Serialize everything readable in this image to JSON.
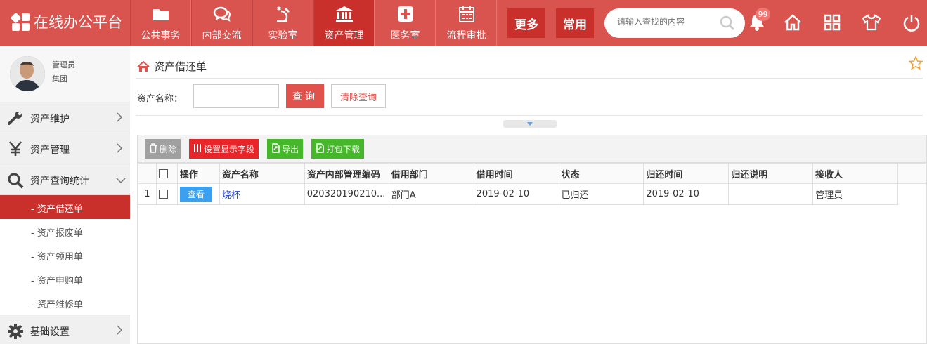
{
  "app": {
    "title": "在线办公平台"
  },
  "nav": [
    {
      "label": "公共事务",
      "icon": "folder-icon"
    },
    {
      "label": "内部交流",
      "icon": "chat-icon"
    },
    {
      "label": "实验室",
      "icon": "lab-icon"
    },
    {
      "label": "资产管理",
      "icon": "bank-icon",
      "active": true
    },
    {
      "label": "医务室",
      "icon": "medical-cross-icon"
    },
    {
      "label": "流程审批",
      "icon": "calendar-icon"
    }
  ],
  "header": {
    "more_label": "更多",
    "common_label": "常用",
    "search_placeholder": "请输入查找的内容",
    "notification_count": "99"
  },
  "user": {
    "name": "管理员",
    "group": "集团"
  },
  "sidebar": {
    "menus": [
      {
        "label": "资产维护",
        "icon": "wrench-icon"
      },
      {
        "label": "资产管理",
        "icon": "yen-icon"
      },
      {
        "label": "资产查询统计",
        "icon": "search-icon",
        "expanded": true
      }
    ],
    "submenu": [
      {
        "label": "- 资产借还单",
        "active": true
      },
      {
        "label": "- 资产报废单"
      },
      {
        "label": "- 资产领用单"
      },
      {
        "label": "- 资产申购单"
      },
      {
        "label": "- 资产维修单"
      }
    ],
    "bottom_menu": {
      "label": "基础设置",
      "icon": "gear-icon"
    }
  },
  "page": {
    "breadcrumb": "资产借还单",
    "filter_label": "资产名称：",
    "query_button": "查询",
    "clear_button": "清除查询"
  },
  "toolbar": {
    "delete": "删除",
    "fields": "设置显示字段",
    "export": "导出",
    "download": "打包下载"
  },
  "colors": {
    "brand": "#d9534f",
    "active": "#c9302c",
    "delete": "#a0a0a0",
    "fields": "#e8262a",
    "green": "#46b62a",
    "view": "#3aa0ef"
  },
  "table": {
    "headers": [
      "操作",
      "资产名称",
      "资产内部管理编码",
      "借用部门",
      "借用时间",
      "状态",
      "归还时间",
      "归还说明",
      "接收人"
    ],
    "rows": [
      {
        "index": "1",
        "action": "查看",
        "name": "烧杯",
        "code": "020320190210...",
        "dept": "部门A",
        "borrow_time": "2019-02-10",
        "status": "已归还",
        "return_time": "2019-02-10",
        "return_note": "",
        "receiver": "管理员"
      }
    ]
  }
}
